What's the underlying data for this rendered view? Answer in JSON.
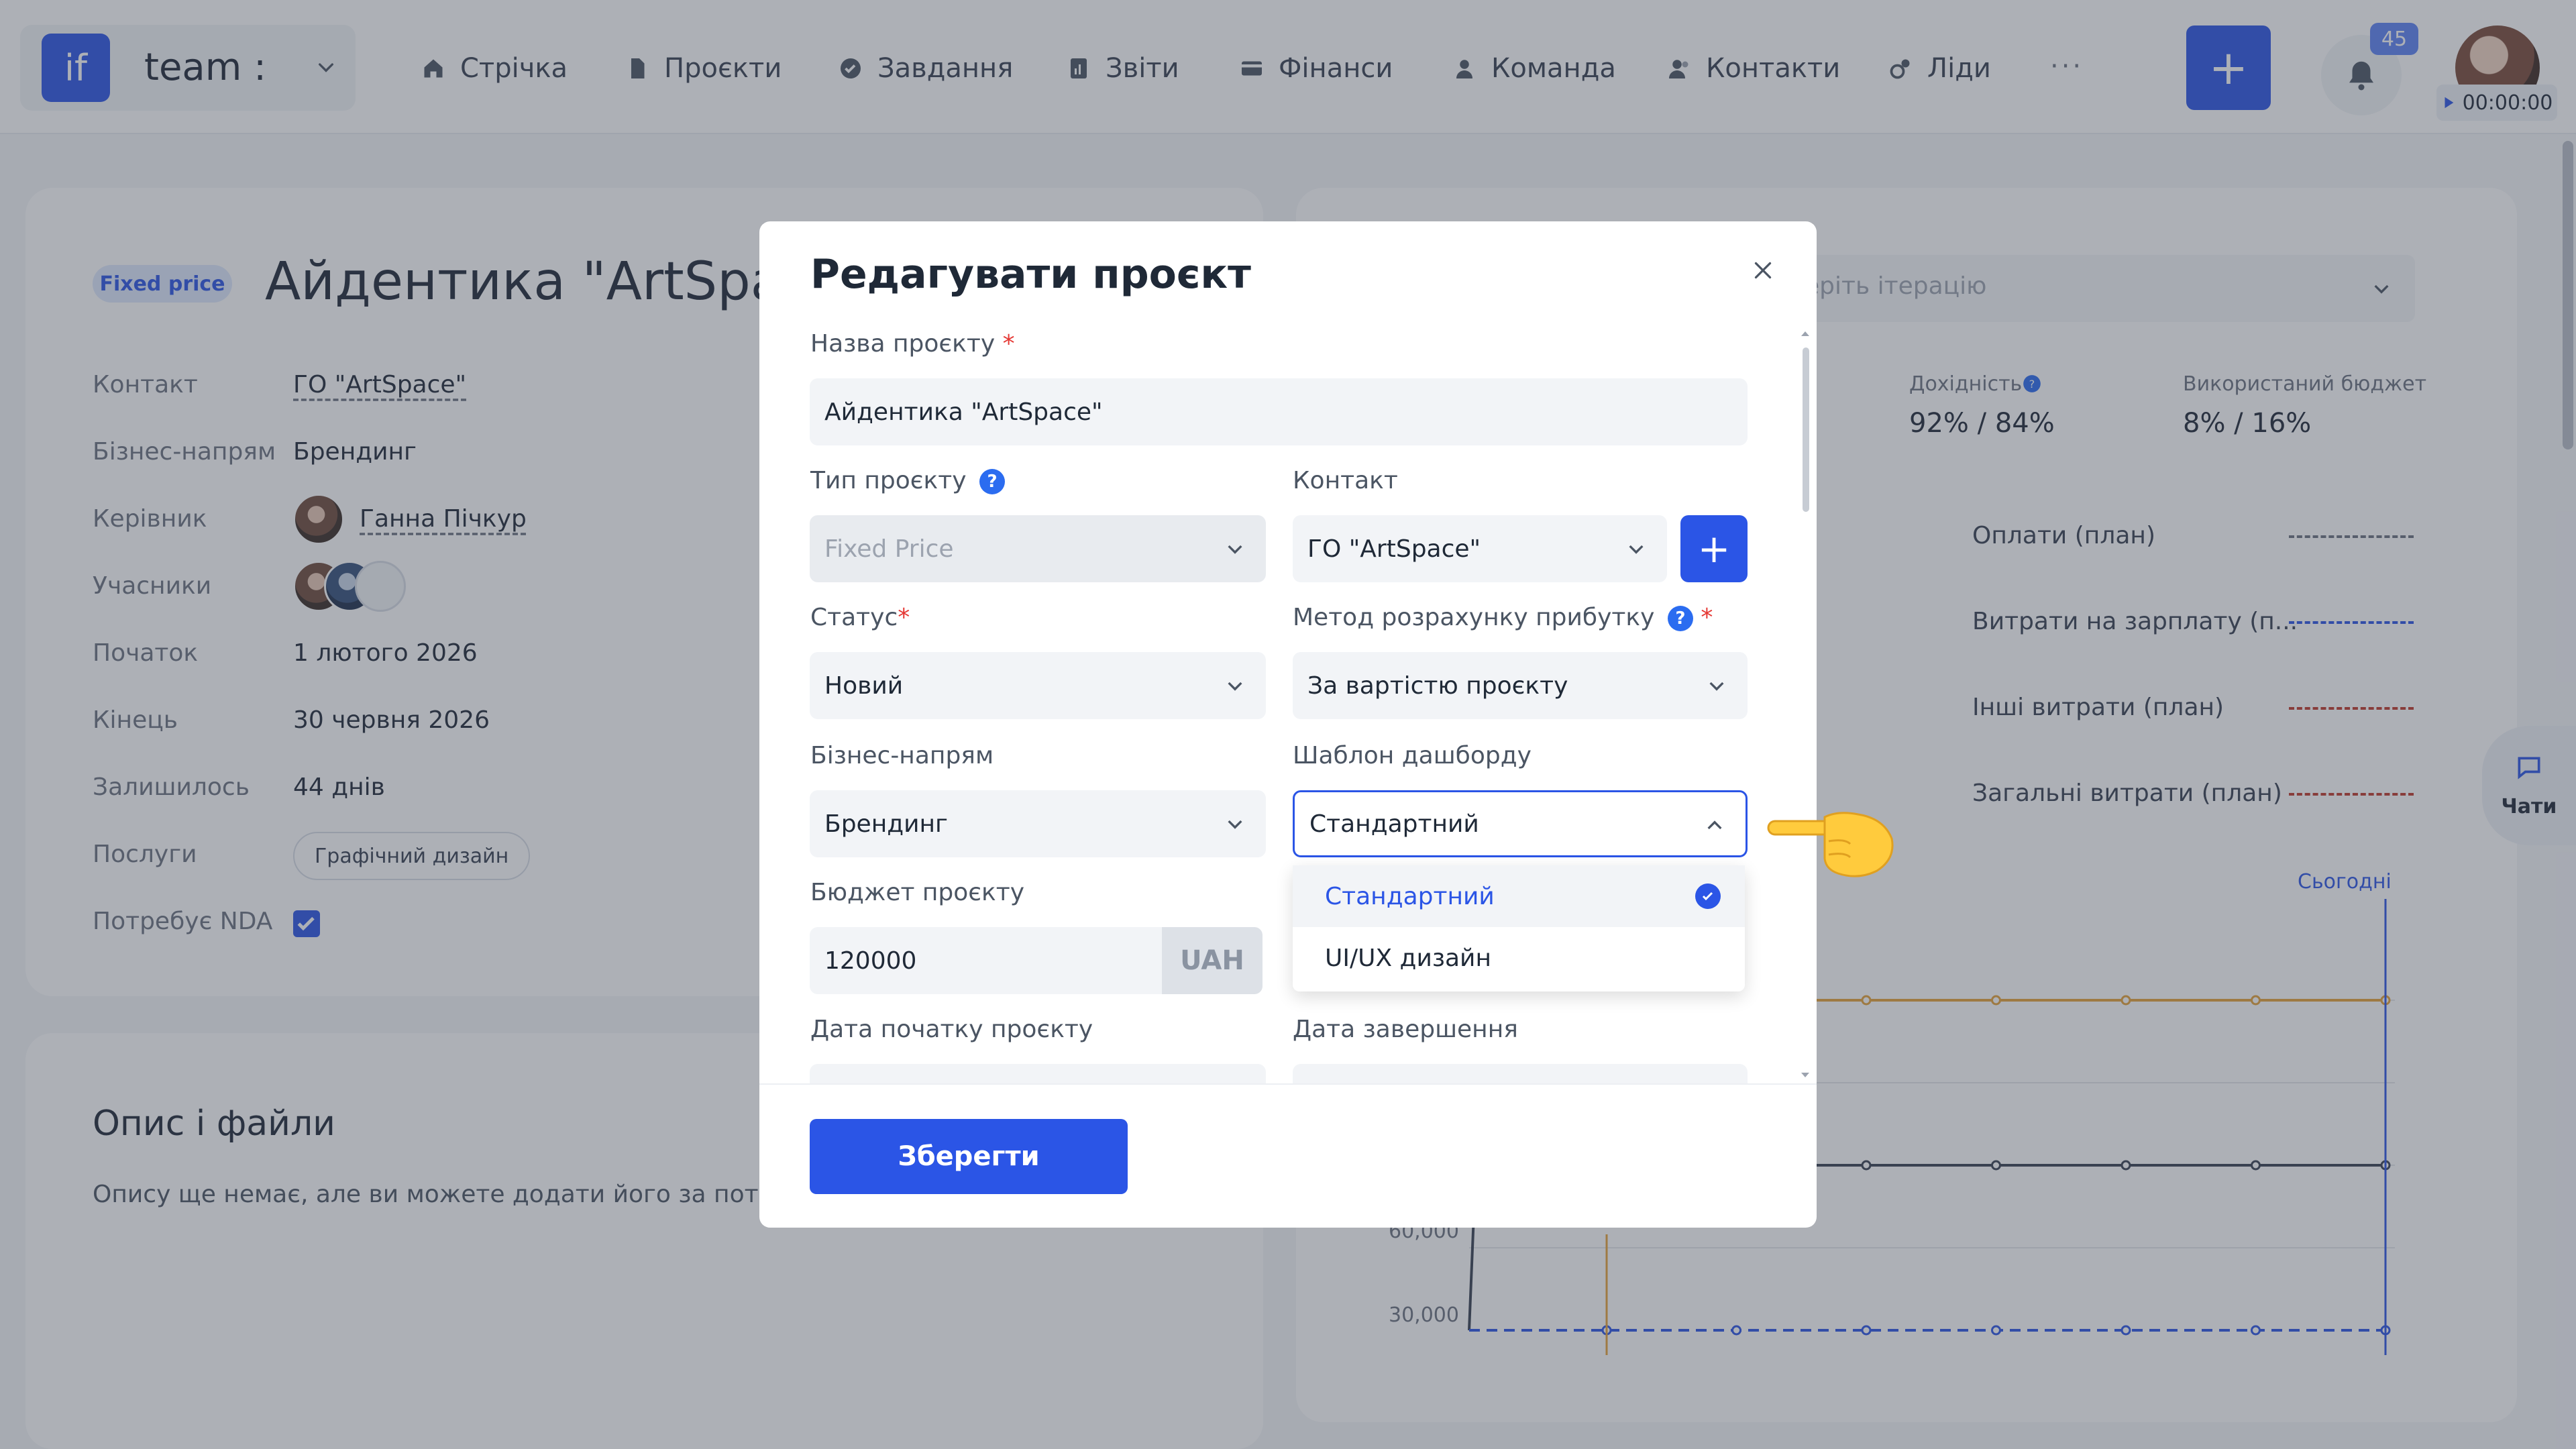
{
  "topbar": {
    "brand_logo": "if",
    "brand_name": "team :",
    "nav": [
      {
        "label": "Стрічка",
        "icon": "home-icon"
      },
      {
        "label": "Проєкти",
        "icon": "document-icon"
      },
      {
        "label": "Завдання",
        "icon": "check-circle-icon"
      },
      {
        "label": "Звіти",
        "icon": "report-icon"
      },
      {
        "label": "Фінанси",
        "icon": "wallet-icon"
      },
      {
        "label": "Команда",
        "icon": "user-icon"
      },
      {
        "label": "Контакти",
        "icon": "contacts-icon"
      },
      {
        "label": "Ліди",
        "icon": "leads-icon"
      }
    ],
    "more": "···",
    "add": "+",
    "notifications_count": "45",
    "timer": "00:00:00"
  },
  "project": {
    "type_tag": "Fixed price",
    "title": "Айдентика \"ArtSpace\"",
    "rows": [
      {
        "label": "Контакт",
        "value": "ГО \"ArtSpace\""
      },
      {
        "label": "Бізнес-напрям",
        "value": "Брендинг"
      },
      {
        "label": "Керівник",
        "value": "Ганна Пічкур"
      },
      {
        "label": "Учасники",
        "value": ""
      },
      {
        "label": "Початок",
        "value": "1 лютого 2026"
      },
      {
        "label": "Кінець",
        "value": "30 червня 2026"
      },
      {
        "label": "Залишилось",
        "value": "44 днів"
      },
      {
        "label": "Послуги",
        "value": "Графічний дизайн"
      },
      {
        "label": "Потребує NDA",
        "value": ""
      }
    ]
  },
  "description": {
    "title": "Опис і файли",
    "text": "Опису ще немає, але ви можете додати його за потреби."
  },
  "dashboard": {
    "iteration_placeholder": "еріть ітерацію",
    "metrics": [
      {
        "label": "Дохідність",
        "value": "92% / 84%"
      },
      {
        "label": "Використаний бюджет",
        "value": "8% / 16%"
      }
    ],
    "legend": [
      {
        "label": "Оплати (план)",
        "color": "#6b7280"
      },
      {
        "label": "Витрати на зарплату (п...",
        "color": "#2b55e6"
      },
      {
        "label": "Інші витрати (план)",
        "color": "#c0392b"
      },
      {
        "label": "Загальні витрати (план)",
        "color": "#c0392b"
      }
    ],
    "today_label": "Сьогодні",
    "chats_label": "Чати"
  },
  "chart_data": {
    "type": "line",
    "yticks": [
      "60,000",
      "30,000"
    ],
    "series": [
      {
        "color": "#374151",
        "values": [
          60000,
          60000,
          60000,
          60000,
          60000,
          60000,
          60000
        ]
      },
      {
        "color": "#2b55e6",
        "values": [
          0,
          0,
          0,
          0,
          0,
          0,
          0
        ]
      },
      {
        "color": "#e5a33a",
        "values": [
          120000,
          120000,
          120000,
          120000,
          120000,
          120000,
          120000
        ]
      }
    ]
  },
  "modal": {
    "title": "Редагувати проєкт",
    "name_label": "Назва проєкту",
    "name_value": "Айдентика \"ArtSpace\"",
    "type_label": "Тип проєкту",
    "type_value": "Fixed Price",
    "contact_label": "Контакт",
    "contact_value": "ГО \"ArtSpace\"",
    "status_label": "Статус",
    "status_value": "Новий",
    "profit_label": "Метод розрахунку прибутку",
    "profit_value": "За вартістю проєкту",
    "direction_label": "Бізнес-напрям",
    "direction_value": "Брендинг",
    "template_label": "Шаблон дашборду",
    "template_value": "Стандартний",
    "template_options": [
      "Стандартний",
      "UI/UX дизайн"
    ],
    "budget_label": "Бюджет проєкту",
    "budget_value": "120000",
    "currency": "UAH",
    "start_label": "Дата початку проєкту",
    "end_label": "Дата завершення",
    "save_label": "Зберегти",
    "required_mark": "*",
    "help_mark": "?"
  }
}
